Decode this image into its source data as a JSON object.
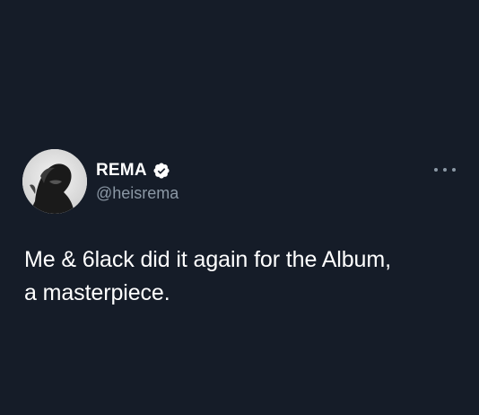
{
  "user": {
    "display_name": "REMA",
    "handle": "@heisrema",
    "avatar_icon": "user-avatar-photo",
    "verified_icon": "verified-badge-icon"
  },
  "tweet": {
    "text_line_1": "Me & 6lack did it again for the Album,",
    "text_line_2": "a masterpiece."
  },
  "actions": {
    "more_icon": "more-options-icon"
  },
  "colors": {
    "background": "#151c28",
    "primary_text": "#ffffff",
    "secondary_text": "#8b98a5"
  }
}
